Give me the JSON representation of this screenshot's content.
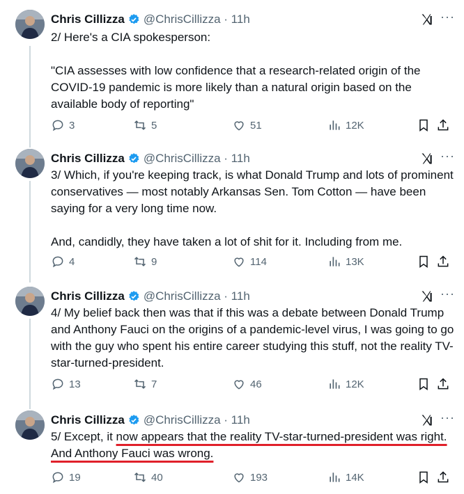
{
  "tweets": [
    {
      "name": "Chris Cillizza",
      "handle": "@ChrisCillizza · 11h",
      "text": [
        "2/ Here's a CIA spokesperson:",
        "\"CIA assesses with low confidence that a research-related origin of the COVID-19 pandemic is more likely than a natural origin based on the available body of reporting\""
      ],
      "replies": "3",
      "reposts": "5",
      "likes": "51",
      "views": "12K"
    },
    {
      "name": "Chris Cillizza",
      "handle": "@ChrisCillizza · 11h",
      "text": [
        "3/ Which, if you're keeping track, is what Donald Trump and lots of prominent conservatives — most notably Arkansas Sen. Tom Cotton — have been saying for a very long time now.",
        "And, candidly, they have taken a lot of shit for it. Including from me."
      ],
      "replies": "4",
      "reposts": "9",
      "likes": "114",
      "views": "13K"
    },
    {
      "name": "Chris Cillizza",
      "handle": "@ChrisCillizza · 11h",
      "text": [
        "4/ My belief back then was that if this was a debate between Donald Trump and Anthony Fauci on the origins of a pandemic-level virus, I was going to go with the guy who spent his entire career studying this stuff, not the reality TV-star-turned-president."
      ],
      "replies": "13",
      "reposts": "7",
      "likes": "46",
      "views": "12K"
    },
    {
      "name": "Chris Cillizza",
      "handle": "@ChrisCillizza · 11h",
      "text_prefix": "5/ Except, it ",
      "text_highlight": "now appears that the reality TV-star-turned-president was right. And Anthony Fauci was wrong.",
      "replies": "19",
      "reposts": "40",
      "likes": "193",
      "views": "14K"
    }
  ],
  "icons": {
    "verified": "verified-badge-icon",
    "platform": "x-logo-icon",
    "more": "more-dots-icon",
    "reply": "reply-icon",
    "repost": "repost-icon",
    "like": "heart-icon",
    "views": "views-chart-icon",
    "bookmark": "bookmark-icon",
    "share": "share-icon"
  },
  "colors": {
    "verified": "#1d9bf0",
    "highlight_underline": "#e0202a",
    "secondary_text": "#536471"
  }
}
